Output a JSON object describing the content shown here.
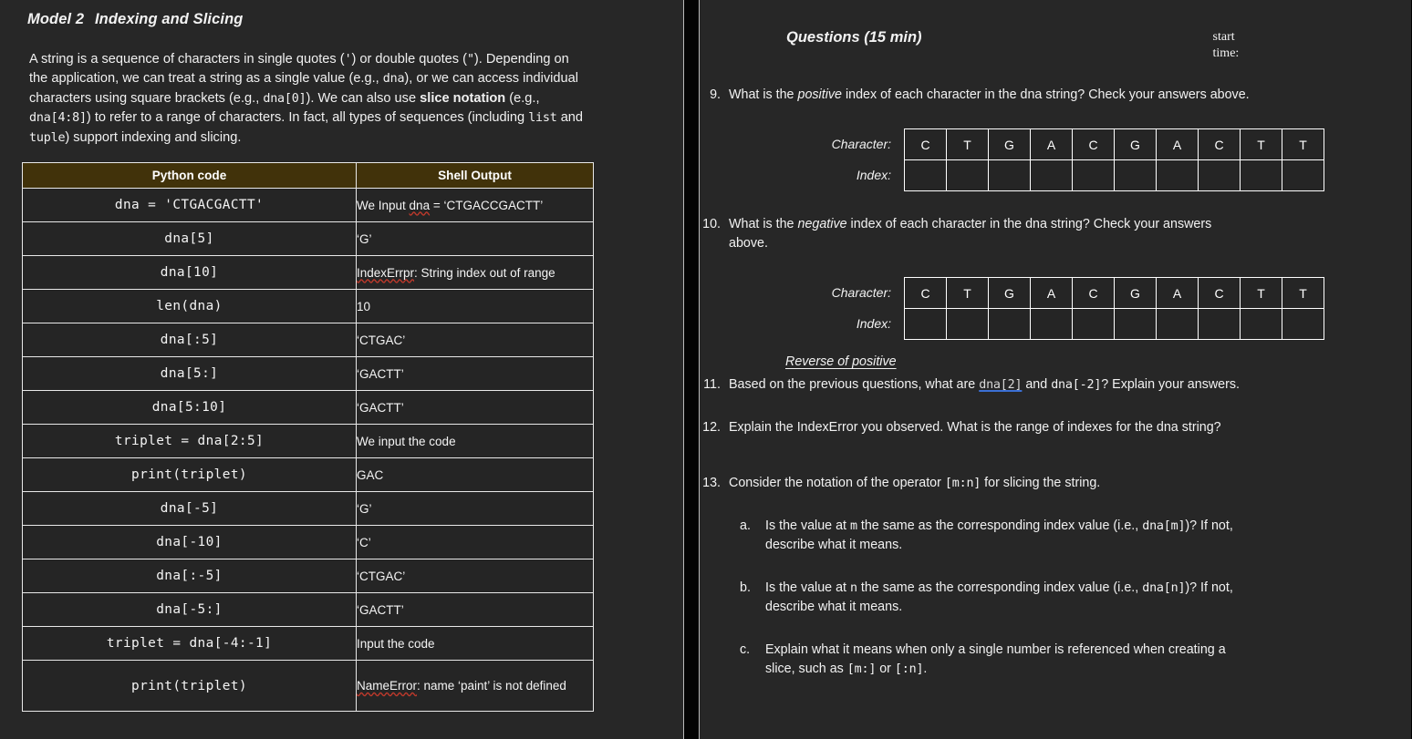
{
  "left_page": {
    "model_label": "Model 2",
    "model_title": "Indexing and Slicing",
    "intro": {
      "p1": "A string is a sequence of characters in single quotes (",
      "q_single": "'",
      "p2": ") or double quotes (",
      "q_double": "\"",
      "p3": "). Depending on the application, we can treat a string as a single value (e.g., ",
      "dna1": "dna",
      "p4": "), or we can access individual characters using square brackets (e.g., ",
      "dna2": "dna[0]",
      "p5": "). We can also use ",
      "slice_bold": "slice notation",
      "p6": " (e.g., ",
      "dna3": "dna[4:8]",
      "p7": ") to refer to a range of characters. In fact, all types of sequences (including ",
      "list_kw": "list",
      "p8": " and ",
      "tuple_kw": "tuple",
      "p9": ") support indexing and slicing."
    },
    "table": {
      "headers": [
        "Python code",
        "Shell Output"
      ],
      "rows": [
        {
          "code": "dna = 'CTGACGACTT'",
          "out_pre": "We Input ",
          "out_sp": "dna",
          "out_post": " = ‘CTGACCGACTT’"
        },
        {
          "code": "dna[5]",
          "out": "‘G’"
        },
        {
          "code": "dna[10]",
          "out_sp": "IndexErrpr",
          "out_post": ": String index out of range"
        },
        {
          "code": "len(dna)",
          "out": "10"
        },
        {
          "code": "dna[:5]",
          "out": "‘CTGAC’"
        },
        {
          "code": "dna[5:]",
          "out": "‘GACTT’"
        },
        {
          "code": "dna[5:10]",
          "out": "‘GACTT’"
        },
        {
          "code": "triplet = dna[2:5]",
          "out": "We input the code"
        },
        {
          "code": "print(triplet)",
          "out": "GAC"
        },
        {
          "code": "dna[-5]",
          "out": "‘G’"
        },
        {
          "code": "dna[-10]",
          "out": "‘C’"
        },
        {
          "code": "dna[:-5]",
          "out": "‘CTGAC’"
        },
        {
          "code": "dna[-5:]",
          "out": "‘GACTT’"
        },
        {
          "code": "triplet = dna[-4:-1]",
          "out": "Input the code"
        },
        {
          "code": "print(triplet)",
          "out_sp": "NameError",
          "out_post": ": name ‘paint’ is not defined"
        }
      ]
    }
  },
  "right_page": {
    "questions_title": "Questions (15 min)",
    "start_time_label": "start\ntime:",
    "q9": {
      "num": "9.",
      "pre": "What is the ",
      "em": "positive",
      "post": " index of each character in the dna string? Check your answers above."
    },
    "q10": {
      "num": "10.",
      "pre": "What is the ",
      "em": "negative",
      "post": " index of each character in the dna string? Check your answers above."
    },
    "char_table": {
      "row_labels": [
        "Character:",
        "Index:"
      ],
      "characters": [
        "C",
        "T",
        "G",
        "A",
        "C",
        "G",
        "A",
        "C",
        "T",
        "T"
      ],
      "indexes": [
        "",
        "",
        "",
        "",
        "",
        "",
        "",
        "",
        "",
        ""
      ]
    },
    "reverse_label": "Reverse of positive",
    "q11": {
      "num": "11.",
      "pre": "Based on the previous questions, what are ",
      "link": "dna[2]",
      "mid": " and ",
      "code": "dna[-2]",
      "post": "? Explain your answers."
    },
    "q12": {
      "num": "12.",
      "text": "Explain the IndexError you observed. What is the range of indexes for the dna string?"
    },
    "q13": {
      "num": "13.",
      "pre": "Consider the notation of the operator ",
      "code": "[m:n]",
      "post": " for slicing the string.",
      "subs": [
        {
          "num": "a.",
          "pre": "Is the value at ",
          "code1": "m",
          "mid": " the same as the corresponding index value (i.e., ",
          "code2": "dna[m]",
          "post": ")? If not, describe what it means."
        },
        {
          "num": "b.",
          "pre": "Is the value at ",
          "code1": "n",
          "mid": " the same as the corresponding index value (i.e., ",
          "code2": "dna[n]",
          "post": ")? If not, describe what it means."
        },
        {
          "num": "c.",
          "pre": "Explain what it means when only a single number is referenced when creating a slice, such as ",
          "code1": "[m:]",
          "mid": " or ",
          "code2": "[:n]",
          "post": "."
        }
      ]
    }
  },
  "colors": {
    "page_background": "#272727",
    "gutter": "#030303",
    "table_header": "#41320a",
    "table_border": "#e9e9e9",
    "text": "#f2f2f2",
    "spellcheck_red": "#c0392b",
    "link_underline": "#3b6fd4"
  }
}
